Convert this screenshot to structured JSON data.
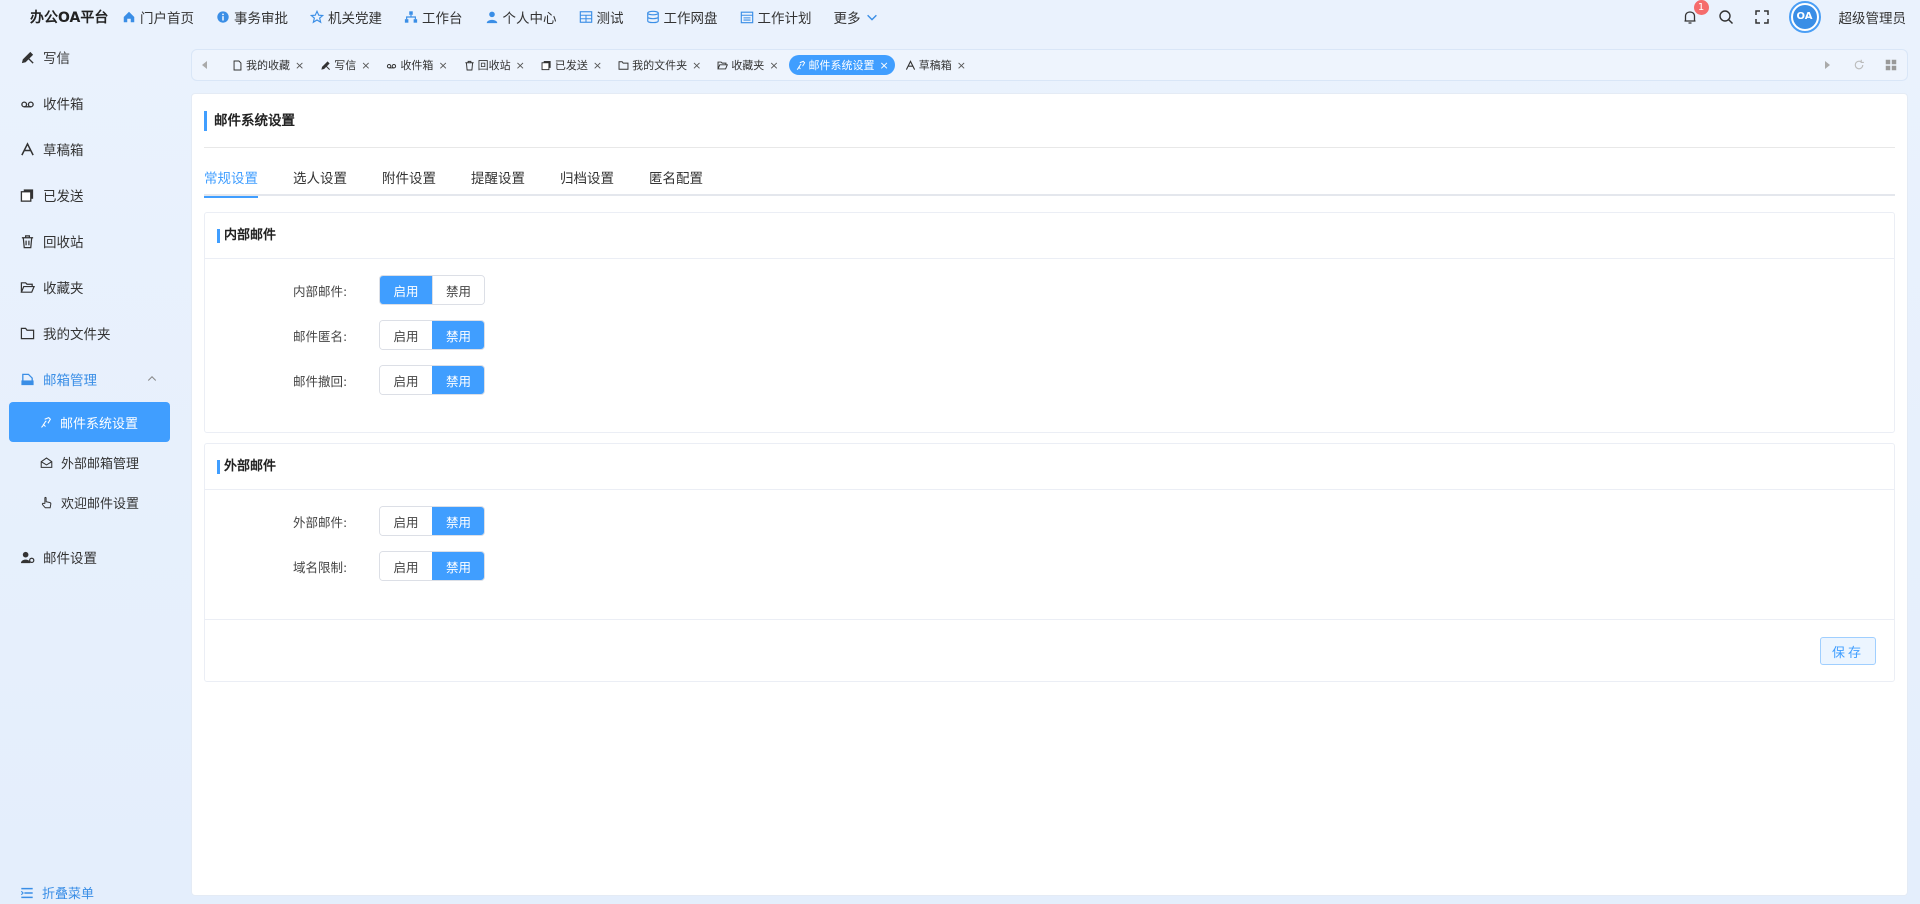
{
  "app": {
    "title": "办公OA平台"
  },
  "topnav": [
    {
      "label": "门户首页",
      "icon": "home-icon"
    },
    {
      "label": "事务审批",
      "icon": "info-icon"
    },
    {
      "label": "机关党建",
      "icon": "star-icon"
    },
    {
      "label": "工作台",
      "icon": "org-icon"
    },
    {
      "label": "个人中心",
      "icon": "user-icon"
    },
    {
      "label": "测试",
      "icon": "grid-icon"
    },
    {
      "label": "工作网盘",
      "icon": "database-icon"
    },
    {
      "label": "工作计划",
      "icon": "calendar-icon"
    },
    {
      "label": "更多",
      "icon": "chevron-down-icon"
    }
  ],
  "header": {
    "notification_count": "1",
    "avatar_text": "OA",
    "username": "超级管理员"
  },
  "sidebar": {
    "items": [
      {
        "label": "写信",
        "icon": "write-icon"
      },
      {
        "label": "收件箱",
        "icon": "inbox-icon"
      },
      {
        "label": "草稿箱",
        "icon": "draft-icon"
      },
      {
        "label": "已发送",
        "icon": "sent-icon"
      },
      {
        "label": "回收站",
        "icon": "trash-icon"
      },
      {
        "label": "收藏夹",
        "icon": "folder-open-icon"
      },
      {
        "label": "我的文件夹",
        "icon": "folder-icon"
      },
      {
        "label": "邮箱管理",
        "icon": "mailbox-icon"
      }
    ],
    "subitems": [
      {
        "label": "邮件系统设置",
        "icon": "settings-icon"
      },
      {
        "label": "外部邮箱管理",
        "icon": "external-mail-icon"
      },
      {
        "label": "欢迎邮件设置",
        "icon": "hand-icon"
      }
    ],
    "settings_item": {
      "label": "邮件设置",
      "icon": "user-settings-icon"
    },
    "fold_label": "折叠菜单"
  },
  "tabs": [
    {
      "label": "我的收藏"
    },
    {
      "label": "写信"
    },
    {
      "label": "收件箱"
    },
    {
      "label": "回收站"
    },
    {
      "label": "已发送"
    },
    {
      "label": "我的文件夹"
    },
    {
      "label": "收藏夹"
    },
    {
      "label": "邮件系统设置"
    },
    {
      "label": "草稿箱"
    }
  ],
  "page": {
    "title": "邮件系统设置",
    "subtabs": [
      "常规设置",
      "选人设置",
      "附件设置",
      "提醒设置",
      "归档设置",
      "匿名配置"
    ],
    "internal": {
      "title": "内部邮件",
      "rows": [
        {
          "label": "内部邮件:",
          "enable": "启用",
          "disable": "禁用",
          "enabled": true
        },
        {
          "label": "邮件匿名:",
          "enable": "启用",
          "disable": "禁用",
          "enabled": false
        },
        {
          "label": "邮件撤回:",
          "enable": "启用",
          "disable": "禁用",
          "enabled": false
        }
      ]
    },
    "external": {
      "title": "外部邮件",
      "rows": [
        {
          "label": "外部邮件:",
          "enable": "启用",
          "disable": "禁用",
          "enabled": false
        },
        {
          "label": "域名限制:",
          "enable": "启用",
          "disable": "禁用",
          "enabled": false
        }
      ]
    },
    "save_label": "保存"
  },
  "colors": {
    "accent": "#409eff",
    "background": "#eaf2fd"
  }
}
